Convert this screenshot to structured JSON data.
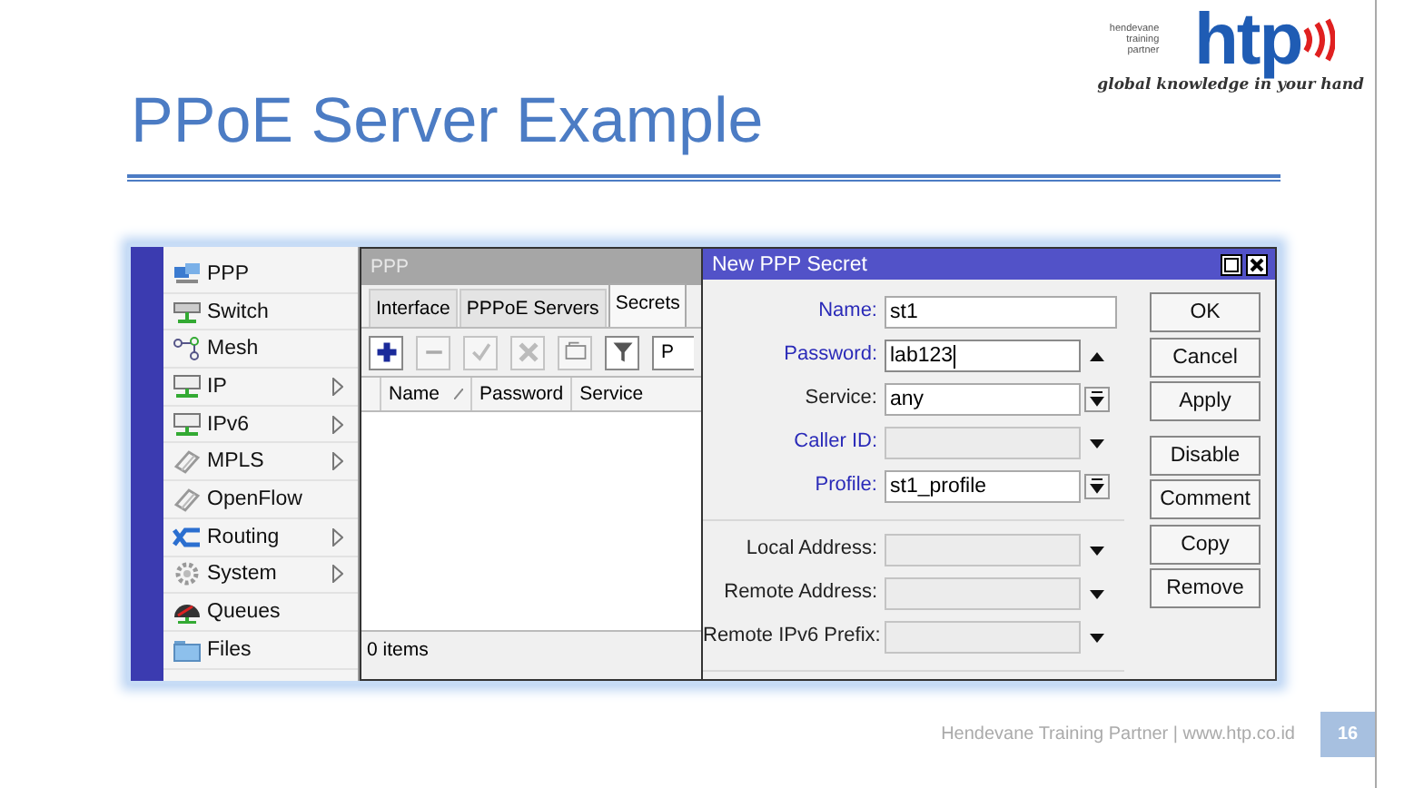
{
  "slide": {
    "title": "PPoE Server Example",
    "footer": "Hendevane Training Partner | www.htp.co.id",
    "page_number": "16"
  },
  "logo": {
    "caption": "hendevane training partner",
    "brand": "htp",
    "tagline": "global knowledge in your hand"
  },
  "menu": [
    {
      "label": "PPP",
      "kind": "ppp",
      "has_submenu": false
    },
    {
      "label": "Switch",
      "kind": "switch",
      "has_submenu": false
    },
    {
      "label": "Mesh",
      "kind": "mesh",
      "has_submenu": false
    },
    {
      "label": "IP",
      "kind": "ip",
      "has_submenu": true
    },
    {
      "label": "IPv6",
      "kind": "ip",
      "has_submenu": true
    },
    {
      "label": "MPLS",
      "kind": "tag",
      "has_submenu": true
    },
    {
      "label": "OpenFlow",
      "kind": "tag",
      "has_submenu": false
    },
    {
      "label": "Routing",
      "kind": "routing",
      "has_submenu": true
    },
    {
      "label": "System",
      "kind": "gear",
      "has_submenu": true
    },
    {
      "label": "Queues",
      "kind": "queues",
      "has_submenu": false
    },
    {
      "label": "Files",
      "kind": "folder",
      "has_submenu": false
    }
  ],
  "ppp_window": {
    "title": "PPP",
    "tabs": [
      {
        "label": "Interface",
        "selected": false
      },
      {
        "label": "PPPoE Servers",
        "selected": false
      },
      {
        "label": "Secrets",
        "selected": true
      }
    ],
    "toolbar": [
      {
        "kind": "add",
        "disabled": false
      },
      {
        "kind": "remove",
        "disabled": true
      },
      {
        "kind": "check",
        "disabled": true
      },
      {
        "kind": "cross",
        "disabled": true
      },
      {
        "kind": "comment",
        "disabled": true
      },
      {
        "kind": "filter",
        "disabled": false
      }
    ],
    "toolbar_cut_button": "P",
    "columns": [
      {
        "label": "Name",
        "sorted": true
      },
      {
        "label": "Password",
        "sorted": false
      },
      {
        "label": "Service",
        "sorted": false
      }
    ],
    "status": "0 items"
  },
  "dialog": {
    "title": "New PPP Secret",
    "sections": [
      [
        {
          "label": "Name:",
          "value": "st1",
          "highlighted": true,
          "enabled": true,
          "focused": false,
          "kind": "plain"
        },
        {
          "label": "Password:",
          "value": "lab123",
          "highlighted": true,
          "enabled": true,
          "focused": true,
          "kind": "up"
        },
        {
          "label": "Service:",
          "value": "any",
          "highlighted": false,
          "enabled": true,
          "focused": false,
          "kind": "dropdown"
        },
        {
          "label": "Caller ID:",
          "highlighted": true,
          "enabled": false,
          "focused": false,
          "kind": "down"
        },
        {
          "label": "Profile:",
          "value": "st1_profile",
          "highlighted": true,
          "enabled": true,
          "focused": false,
          "kind": "dropdown"
        }
      ],
      [
        {
          "label": "Local Address:",
          "highlighted": false,
          "enabled": false,
          "focused": false,
          "kind": "down"
        },
        {
          "label": "Remote Address:",
          "highlighted": false,
          "enabled": false,
          "focused": false,
          "kind": "down"
        },
        {
          "label": "Remote IPv6 Prefix:",
          "highlighted": false,
          "enabled": false,
          "focused": false,
          "kind": "down"
        }
      ]
    ],
    "buttons": [
      "OK",
      "Cancel",
      "Apply",
      "Disable",
      "Comment",
      "Copy",
      "Remove"
    ]
  }
}
